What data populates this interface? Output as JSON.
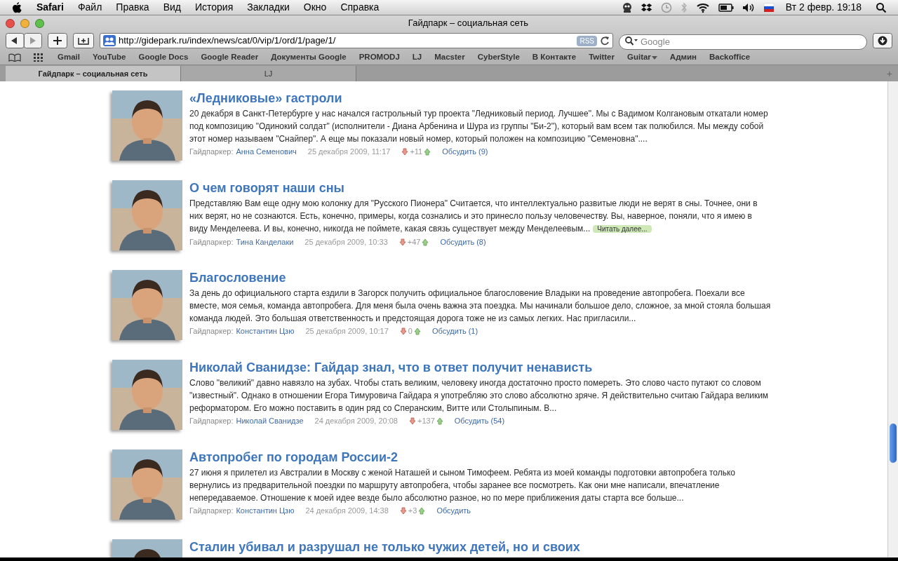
{
  "menubar": {
    "app": "Safari",
    "items": [
      "Файл",
      "Правка",
      "Вид",
      "История",
      "Закладки",
      "Окно",
      "Справка"
    ],
    "clock": "Вт 2 февр.  19:18"
  },
  "window": {
    "title": "Гайдпарк – социальная сеть"
  },
  "toolbar": {
    "url": "http://gidepark.ru/index/news/cat/0/vip/1/ord/1/page/1/",
    "rss": "RSS",
    "search": {
      "placeholder": "Google"
    }
  },
  "bookmarks": [
    {
      "label": "Gmail"
    },
    {
      "label": "YouTube"
    },
    {
      "label": "Google Docs"
    },
    {
      "label": "Google Reader"
    },
    {
      "label": "Документы Google"
    },
    {
      "label": "PROMODJ"
    },
    {
      "label": "LJ"
    },
    {
      "label": "Macster"
    },
    {
      "label": "CyberStyle"
    },
    {
      "label": "В Контакте"
    },
    {
      "label": "Twitter"
    },
    {
      "label": "Guitar",
      "menu": true
    },
    {
      "label": "Админ"
    },
    {
      "label": "Backoffice"
    }
  ],
  "tabs": [
    {
      "label": "Гайдпарк – социальная сеть",
      "selected": true
    },
    {
      "label": "LJ",
      "selected": false
    }
  ],
  "new_tab": "+",
  "articles": [
    {
      "title": "«Ледниковые» гастроли",
      "body": "20 декабря в Санкт-Петербурге у нас начался гастрольный тур проекта \"Ледниковый период. Лучшее\". Мы с Вадимом Колгановым откатали номер под композицию \"Одинокий солдат\" (исполнители - Диана Арбенина и Шура из группы \"Би-2\"), который вам всем так полюбился. Мы между собой этот номер называем \"Снайпер\". А еще мы показали новый номер, который положен на композицию \"Семеновна\"....",
      "author_label": "Гайдпаркер:",
      "author": "Анна Семенович",
      "date": "25 декабря 2009, 11:17",
      "votes": "+11",
      "discuss": "Обсудить (9)"
    },
    {
      "title": "О чем говорят наши сны",
      "body": "Представляю Вам еще одну мою колонку для \"Русского Пионера\" Считается, что интеллектуально развитые люди не верят в сны. Точнее, они в них верят, но не сознаются. Есть, конечно, примеры, когда сознались и это принесло пользу человечеству. Вы, наверное, поняли, что я имею в виду Менделеева. И вы, конечно, никогда не поймете, какая связь существует между Менделеевым...",
      "read_more": "Читать далее...",
      "author_label": "Гайдпаркер:",
      "author": "Тина Канделаки",
      "date": "25 декабря 2009, 10:33",
      "votes": "+47",
      "discuss": "Обсудить (8)"
    },
    {
      "title": "Благословение",
      "body": "За день до официального старта ездили в Загорск получить официальное благословение Владыки на проведение автопробега. Поехали все вместе, моя семья, команда автопробега. Для меня была очень важна эта поездка. Мы начинали большое дело, сложное, за мной стояла большая команда людей. Это большая ответственность и предстоящая дорога тоже не из самых легких. Нас пригласили...",
      "author_label": "Гайдпаркер:",
      "author": "Константин Цзю",
      "date": "25 декабря 2009, 10:17",
      "votes": "0",
      "discuss": "Обсудить (1)"
    },
    {
      "title": "Николай Сванидзе: Гайдар знал, что в ответ получит ненависть",
      "body": "Слово \"великий\" давно навязло на зубах. Чтобы стать великим, человеку иногда достаточно просто помереть. Это слово часто путают со словом \"известный\". Однако в отношении Егора Тимуровича Гайдара я употребляю это слово абсолютно зряче. Я действительно считаю Гайдара великим реформатором. Его можно поставить в один ряд со Сперанским, Витте или Столыпиным. В...",
      "author_label": "Гайдпаркер:",
      "author": "Николай Сванидзе",
      "date": "24 декабря 2009, 20:08",
      "votes": "+137",
      "discuss": "Обсудить (54)"
    },
    {
      "title": "Автопробег по городам России-2",
      "body": "27 июня я прилетел из Австралии в Москву с женой Наташей и сыном Тимофеем. Ребята из моей команды подготовки автопробега только вернулись из предварительной поездки по маршруту автопробега, чтобы заранее все посмотреть. Как они мне написали, впечатление непередаваемое. Отношение к моей идее везде было абсолютно разное, но по мере приближения даты старта все больше...",
      "author_label": "Гайдпаркер:",
      "author": "Константин Цзю",
      "date": "24 декабря 2009, 14:38",
      "votes": "+3",
      "discuss": "Обсудить"
    },
    {
      "title": "Сталин убивал и разрушал не только чужих детей, но и своих"
    }
  ]
}
